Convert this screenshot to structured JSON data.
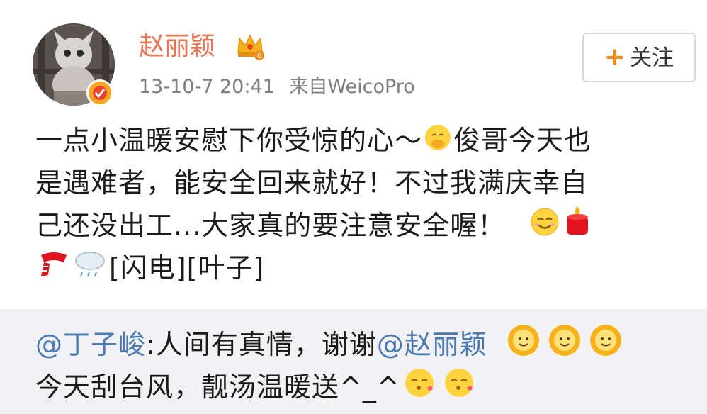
{
  "post": {
    "username": "赵丽颖",
    "timestamp": "13-10-7 20:41",
    "source": "来自WeicoPro",
    "follow_button": {
      "icon": "plus-icon",
      "label": "关注"
    },
    "content": {
      "line1_a": "一点小温暖安慰下你受惊的心～",
      "line1_b": "俊哥今天也",
      "line2": "是遇难者，能安全回来就好！不过我满庆幸自",
      "line3": "己还没出工...大家真的要注意安全喔！",
      "line4_text": "[闪电][叶子]"
    }
  },
  "repost": {
    "mention_user": "@丁子峻",
    "text_a": ":人间有真情，谢谢",
    "mention_author": "@赵丽颖",
    "line2": "今天刮台风，靓汤温暖送^_^"
  },
  "colors": {
    "username": "#eb7350",
    "mention": "#4a7ab0",
    "repost_bg": "#f2f2f5",
    "accent": "#f28c1c"
  },
  "icons": [
    "crown-badge-icon",
    "verified-badge-icon",
    "plus-icon",
    "hug-emoji-icon",
    "smile-emoji-icon",
    "candle-emoji-icon",
    "scarf-emoji-icon",
    "rain-cloud-emoji-icon",
    "sunflower-emoji-icon",
    "kiss-emoji-icon"
  ]
}
